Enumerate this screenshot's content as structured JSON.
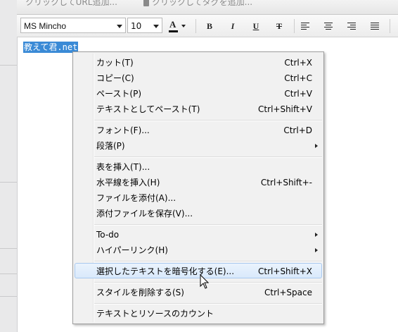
{
  "header": {
    "url_hint": "クリックしてURL追加...",
    "tag_hint": "クリックしてタグを追加..."
  },
  "toolbar": {
    "font": "MS Mincho",
    "size": "10",
    "color_letter": "A",
    "bold": "B",
    "italic": "I",
    "underline": "U",
    "strike": "T"
  },
  "editor": {
    "selected_text": "教えて君.net"
  },
  "menu": {
    "items": [
      {
        "label": "カット(T)",
        "shortcut": "Ctrl+X"
      },
      {
        "label": "コピー(C)",
        "shortcut": "Ctrl+C"
      },
      {
        "label": "ペースト(P)",
        "shortcut": "Ctrl+V"
      },
      {
        "label": "テキストとしてペースト(T)",
        "shortcut": "Ctrl+Shift+V"
      },
      {
        "label": "フォント(F)...",
        "shortcut": "Ctrl+D"
      },
      {
        "label": "段落(P)",
        "shortcut": ""
      },
      {
        "label": "表を挿入(T)...",
        "shortcut": ""
      },
      {
        "label": "水平線を挿入(H)",
        "shortcut": "Ctrl+Shift+-"
      },
      {
        "label": "ファイルを添付(A)...",
        "shortcut": ""
      },
      {
        "label": "添付ファイルを保存(V)...",
        "shortcut": ""
      },
      {
        "label": "To-do",
        "shortcut": ""
      },
      {
        "label": "ハイパーリンク(H)",
        "shortcut": ""
      },
      {
        "label": "選択したテキストを暗号化する(E)...",
        "shortcut": "Ctrl+Shift+X"
      },
      {
        "label": "スタイルを削除する(S)",
        "shortcut": "Ctrl+Space"
      },
      {
        "label": "テキストとリソースのカウント",
        "shortcut": ""
      }
    ]
  }
}
